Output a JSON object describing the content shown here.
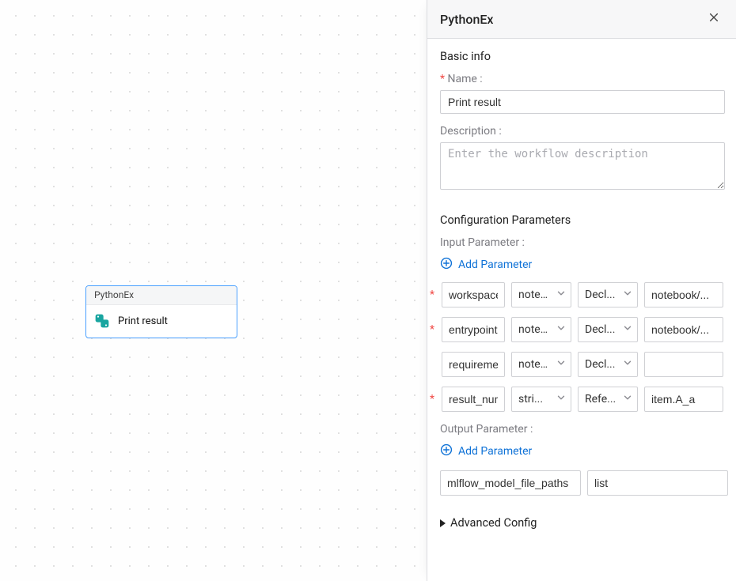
{
  "panel": {
    "title": "PythonEx",
    "basic_info_heading": "Basic info",
    "name_label": "Name",
    "name_value": "Print result",
    "description_label": "Description",
    "description_placeholder": "Enter the workflow description",
    "config_heading": "Configuration Parameters",
    "input_param_label": "Input Parameter :",
    "output_param_label": "Output Parameter :",
    "add_parameter_label": "Add Parameter",
    "advanced_config_label": "Advanced Config"
  },
  "input_params": [
    {
      "required": true,
      "name": "workspace",
      "type": "notebook",
      "mode": "Decl...",
      "value": "notebook/..."
    },
    {
      "required": true,
      "name": "entrypoint",
      "type": "notebook",
      "mode": "Decl...",
      "value": "notebook/..."
    },
    {
      "required": false,
      "name": "requireme",
      "type": "notebook",
      "mode": "Decl...",
      "value": ""
    },
    {
      "required": true,
      "name": "result_num",
      "type": "stri...",
      "mode": "Refe...",
      "value": "item.A_a"
    }
  ],
  "output_params": [
    {
      "name": "mlflow_model_file_paths",
      "type": "list"
    }
  ],
  "node": {
    "type": "PythonEx",
    "title": "Print result"
  }
}
